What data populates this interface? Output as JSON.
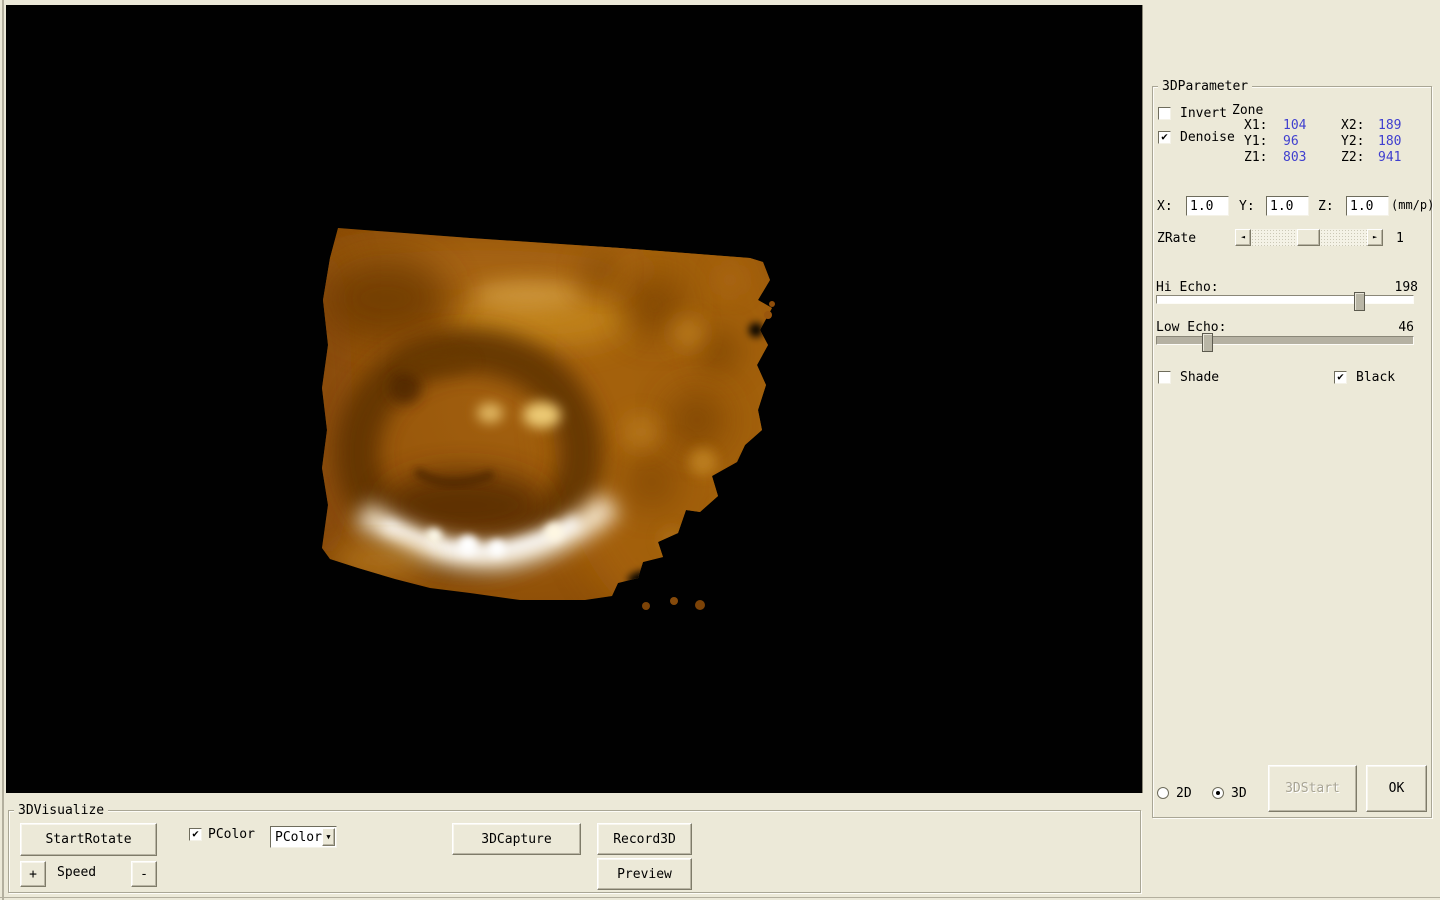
{
  "colors": {
    "window_bg": "#ece9d8",
    "viewport_bg": "#000000",
    "value_blue": "#3f3fcf",
    "volume_base": "#9d5a0e",
    "volume_dark": "#5d3103",
    "volume_highlight": "#ffffff"
  },
  "icons": {
    "check": "✔",
    "dropdown_arrow": "▼",
    "scroll_left": "◄",
    "scroll_right": "►"
  },
  "right_panel": {
    "group_label": "3DParameter",
    "invert": {
      "label": "Invert",
      "checked": false
    },
    "denoise": {
      "label": "Denoise",
      "checked": true
    },
    "zone": {
      "label": "Zone",
      "x1_label": "X1:",
      "x1": "104",
      "x2_label": "X2:",
      "x2": "189",
      "y1_label": "Y1:",
      "y1": "96",
      "y2_label": "Y2:",
      "y2": "180",
      "z1_label": "Z1:",
      "z1": "803",
      "z2_label": "Z2:",
      "z2": "941"
    },
    "scale": {
      "x_label": "X:",
      "x_value": "1.0",
      "y_label": "Y:",
      "y_value": "1.0",
      "z_label": "Z:",
      "z_value": "1.0",
      "unit": "(mm/p)"
    },
    "zrate": {
      "label": "ZRate",
      "value": "1"
    },
    "hi_echo": {
      "label": "Hi Echo:",
      "value": "198"
    },
    "low_echo": {
      "label": "Low Echo:",
      "value": "46"
    },
    "shade": {
      "label": "Shade",
      "checked": false
    },
    "black": {
      "label": "Black",
      "checked": true
    },
    "mode": {
      "d2_label": "2D",
      "d2_selected": false,
      "d3_label": "3D",
      "d3_selected": true
    },
    "start3d_button": {
      "label": "3DStart",
      "enabled": false
    },
    "ok_button": {
      "label": "OK"
    }
  },
  "bottom_panel": {
    "group_label": "3DVisualize",
    "start_rotate_button": "StartRotate",
    "pcolor_checkbox": {
      "label": "PColor",
      "checked": true
    },
    "pcolor_dropdown": {
      "value": "PColor"
    },
    "capture_button": "3DCapture",
    "record_button": "Record3D",
    "preview_button": "Preview",
    "speed": {
      "plus": "+",
      "label": "Speed",
      "minus": "-"
    }
  }
}
